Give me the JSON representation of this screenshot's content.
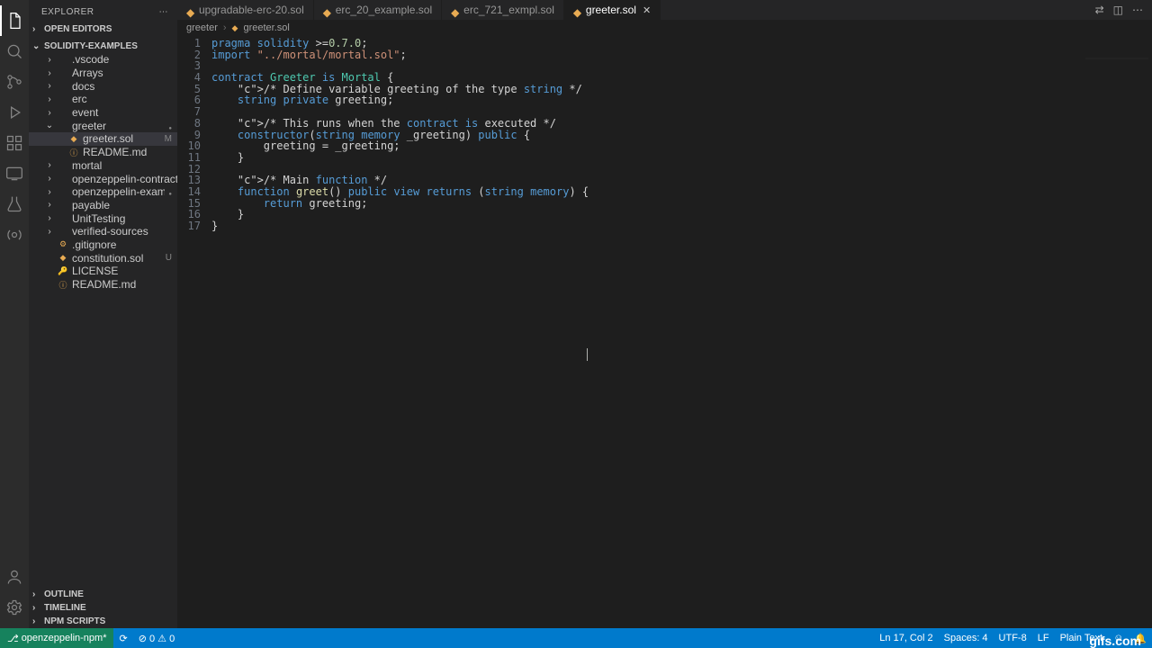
{
  "explorer": {
    "title": "EXPLORER"
  },
  "panels": {
    "open_editors": "OPEN EDITORS",
    "project": "SOLIDITY-EXAMPLES",
    "outline": "OUTLINE",
    "timeline": "TIMELINE",
    "npm": "NPM SCRIPTS"
  },
  "tree": [
    {
      "label": ".vscode",
      "type": "folder",
      "depth": 1
    },
    {
      "label": "Arrays",
      "type": "folder",
      "depth": 1
    },
    {
      "label": "docs",
      "type": "folder",
      "depth": 1
    },
    {
      "label": "erc",
      "type": "folder",
      "depth": 1
    },
    {
      "label": "event",
      "type": "folder",
      "depth": 1
    },
    {
      "label": "greeter",
      "type": "folder",
      "depth": 1,
      "expanded": true,
      "dot": true
    },
    {
      "label": "greeter.sol",
      "type": "file",
      "depth": 2,
      "selected": true,
      "badge": "M",
      "icon": "◆"
    },
    {
      "label": "README.md",
      "type": "file",
      "depth": 2,
      "icon": "ⓘ"
    },
    {
      "label": "mortal",
      "type": "folder",
      "depth": 1
    },
    {
      "label": "openzeppelin-contracts",
      "type": "folder",
      "depth": 1
    },
    {
      "label": "openzeppelin-example",
      "type": "folder",
      "depth": 1,
      "dot": true
    },
    {
      "label": "payable",
      "type": "folder",
      "depth": 1
    },
    {
      "label": "UnitTesting",
      "type": "folder",
      "depth": 1
    },
    {
      "label": "verified-sources",
      "type": "folder",
      "depth": 1
    },
    {
      "label": ".gitignore",
      "type": "file",
      "depth": 1,
      "icon": "⚙"
    },
    {
      "label": "constitution.sol",
      "type": "file",
      "depth": 1,
      "badge": "U",
      "icon": "◆"
    },
    {
      "label": "LICENSE",
      "type": "file",
      "depth": 1,
      "icon": "🔑"
    },
    {
      "label": "README.md",
      "type": "file",
      "depth": 1,
      "icon": "ⓘ"
    }
  ],
  "tabs": [
    {
      "label": "upgradable-erc-20.sol"
    },
    {
      "label": "erc_20_example.sol"
    },
    {
      "label": "erc_721_exmpl.sol"
    },
    {
      "label": "greeter.sol",
      "active": true,
      "close": true
    }
  ],
  "breadcrumb": {
    "folder": "greeter",
    "file": "greeter.sol"
  },
  "code_lines": [
    "pragma solidity >=0.7.0;",
    "import \"../mortal/mortal.sol\";",
    "",
    "contract Greeter is Mortal {",
    "    /* Define variable greeting of the type string */",
    "    string private greeting;",
    "",
    "    /* This runs when the contract is executed */",
    "    constructor(string memory _greeting) public {",
    "        greeting = _greeting;",
    "    }",
    "",
    "    /* Main function */",
    "    function greet() public view returns (string memory) {",
    "        return greeting;",
    "    }",
    "}"
  ],
  "status": {
    "branch": "openzeppelin-npm*",
    "sync": "⟳",
    "errors": "⊘ 0 ⚠ 0",
    "lncol": "Ln 17, Col 2",
    "spaces": "Spaces: 4",
    "encoding": "UTF-8",
    "eol": "LF",
    "lang": "Plain Text",
    "feedback": "☺"
  },
  "watermark": "gifs.com"
}
